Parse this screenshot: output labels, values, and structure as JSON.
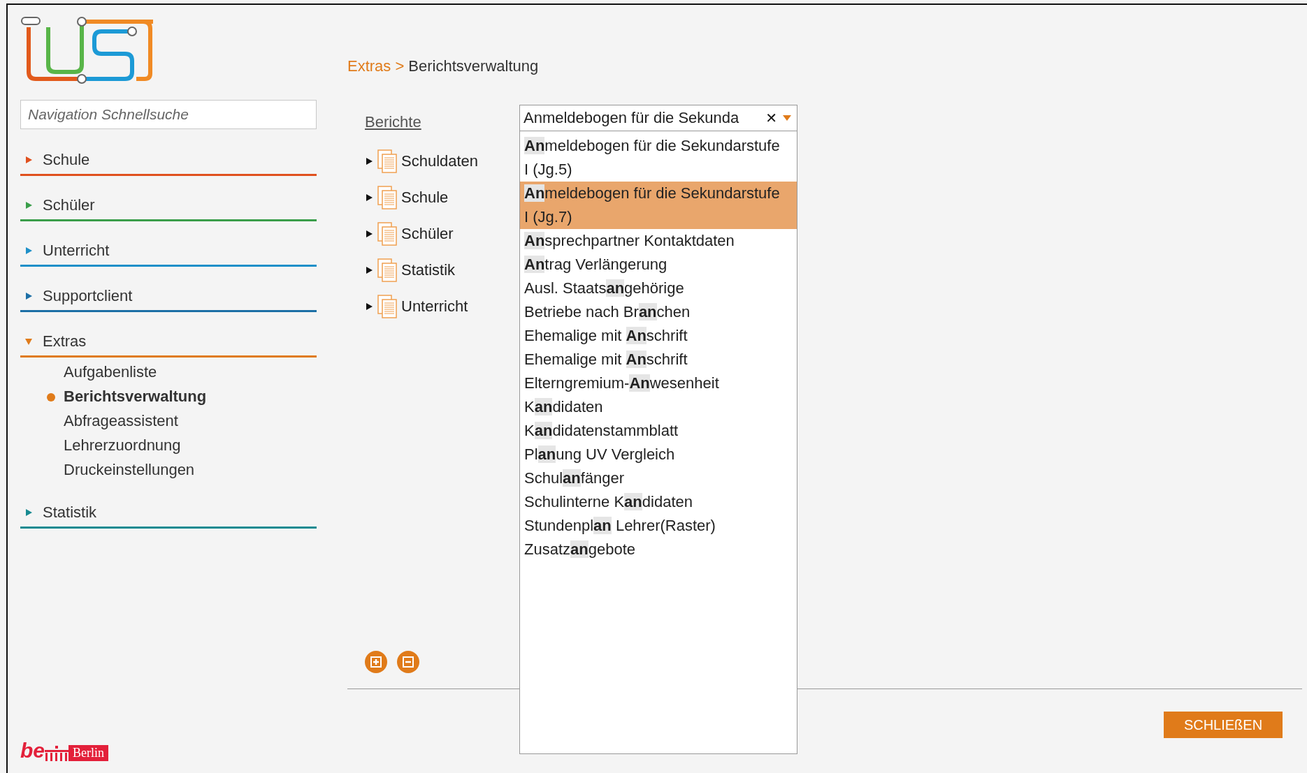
{
  "sidebar": {
    "search": {
      "placeholder": "Navigation Schnellsuche"
    },
    "sections": [
      {
        "label": "Schule",
        "color": "#e0501e",
        "expanded": false
      },
      {
        "label": "Schüler",
        "color": "#3a9e4a",
        "expanded": false
      },
      {
        "label": "Unterricht",
        "color": "#1e90c8",
        "expanded": false
      },
      {
        "label": "Supportclient",
        "color": "#1c6fa6",
        "expanded": false
      },
      {
        "label": "Extras",
        "color": "#e07b1a",
        "expanded": true,
        "children": [
          {
            "label": "Aufgabenliste",
            "selected": false
          },
          {
            "label": "Berichtsverwaltung",
            "selected": true
          },
          {
            "label": "Abfrageassistent",
            "selected": false
          },
          {
            "label": "Lehrerzuordnung",
            "selected": false
          },
          {
            "label": "Druckeinstellungen",
            "selected": false
          }
        ]
      },
      {
        "label": "Statistik",
        "color": "#178a91",
        "expanded": false
      }
    ]
  },
  "breadcrumb": {
    "parent": "Extras",
    "separator": ">",
    "current": "Berichtsverwaltung"
  },
  "reports": {
    "label": "Berichte",
    "tree": [
      {
        "label": "Schuldaten",
        "expanded": false
      },
      {
        "label": "Schule",
        "expanded": false
      },
      {
        "label": "Schüler",
        "expanded": false
      },
      {
        "label": "Statistik",
        "expanded": false
      },
      {
        "label": "Unterricht",
        "expanded": false
      }
    ],
    "select": {
      "value": "Anmeldebogen für die Sekunda",
      "clear": "✕",
      "options": [
        {
          "match": "An",
          "post": "meldebogen für die Sekundarstufe I (Jg.5)",
          "selected": false
        },
        {
          "match": "An",
          "post": "meldebogen für die Sekundarstufe I (Jg.7)",
          "selected": true
        },
        {
          "match": "An",
          "post": "sprechpartner Kontaktdaten",
          "selected": false
        },
        {
          "match": "An",
          "post": "trag Verlängerung",
          "selected": false
        },
        {
          "pre": "Ausl. Staats",
          "match": "an",
          "post": "gehörige",
          "selected": false
        },
        {
          "pre": "Betriebe nach Br",
          "match": "an",
          "post": "chen",
          "selected": false
        },
        {
          "pre": "Ehemalige mit ",
          "match": "An",
          "post": "schrift",
          "selected": false
        },
        {
          "pre": "Ehemalige mit ",
          "match": "An",
          "post": "schrift",
          "selected": false
        },
        {
          "pre": "Elterngremium-",
          "match": "An",
          "post": "wesenheit",
          "selected": false
        },
        {
          "pre": "K",
          "match": "an",
          "post": "didaten",
          "selected": false
        },
        {
          "pre": "K",
          "match": "an",
          "post": "didatenstammblatt",
          "selected": false
        },
        {
          "pre": "Pl",
          "match": "an",
          "post": "ung UV Vergleich",
          "selected": false
        },
        {
          "pre": "Schul",
          "match": "an",
          "post": "fänger",
          "selected": false
        },
        {
          "pre": "Schulinterne K",
          "match": "an",
          "post": "didaten",
          "selected": false
        },
        {
          "pre": "Stundenpl",
          "match": "an",
          "post": " Lehrer(Raster)",
          "selected": false
        },
        {
          "pre": "Zusatz",
          "match": "an",
          "post": "gebote",
          "selected": false
        }
      ]
    }
  },
  "footer": {
    "close_button": "SCHLIEßEN",
    "logo": {
      "mark": "be",
      "text": "Berlin"
    }
  }
}
